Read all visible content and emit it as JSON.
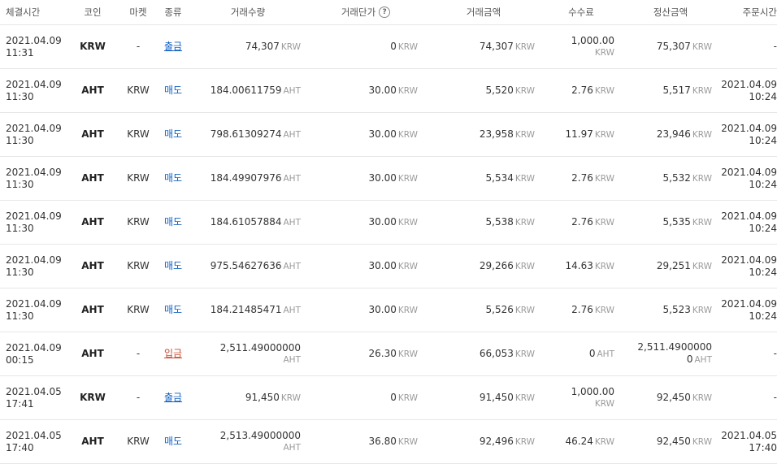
{
  "headers": {
    "time": "체결시간",
    "coin": "코인",
    "market": "마켓",
    "type": "종류",
    "volume": "거래수량",
    "price": "거래단가",
    "amount": "거래금액",
    "fee": "수수료",
    "settle": "정산금액",
    "order_time": "주문시간"
  },
  "help_icon": "?",
  "rows": [
    {
      "date": "2021.04.09",
      "time": "11:31",
      "coin": "KRW",
      "market": "-",
      "type": "출금",
      "type_kind": "withdraw",
      "volume": "74,307",
      "volume_unit": "KRW",
      "price": "0",
      "price_unit": "KRW",
      "amount": "74,307",
      "amount_unit": "KRW",
      "fee": "1,000.00",
      "fee_unit": "KRW",
      "fee_wrap": true,
      "settle": "75,307",
      "settle_unit": "KRW",
      "settle_wrap": false,
      "order_date": "-",
      "order_time": ""
    },
    {
      "date": "2021.04.09",
      "time": "11:30",
      "coin": "AHT",
      "market": "KRW",
      "type": "매도",
      "type_kind": "sell",
      "volume": "184.00611759",
      "volume_unit": "AHT",
      "price": "30.00",
      "price_unit": "KRW",
      "amount": "5,520",
      "amount_unit": "KRW",
      "fee": "2.76",
      "fee_unit": "KRW",
      "fee_wrap": false,
      "settle": "5,517",
      "settle_unit": "KRW",
      "settle_wrap": false,
      "order_date": "2021.04.09",
      "order_time": "10:24"
    },
    {
      "date": "2021.04.09",
      "time": "11:30",
      "coin": "AHT",
      "market": "KRW",
      "type": "매도",
      "type_kind": "sell",
      "volume": "798.61309274",
      "volume_unit": "AHT",
      "price": "30.00",
      "price_unit": "KRW",
      "amount": "23,958",
      "amount_unit": "KRW",
      "fee": "11.97",
      "fee_unit": "KRW",
      "fee_wrap": false,
      "settle": "23,946",
      "settle_unit": "KRW",
      "settle_wrap": false,
      "order_date": "2021.04.09",
      "order_time": "10:24"
    },
    {
      "date": "2021.04.09",
      "time": "11:30",
      "coin": "AHT",
      "market": "KRW",
      "type": "매도",
      "type_kind": "sell",
      "volume": "184.49907976",
      "volume_unit": "AHT",
      "price": "30.00",
      "price_unit": "KRW",
      "amount": "5,534",
      "amount_unit": "KRW",
      "fee": "2.76",
      "fee_unit": "KRW",
      "fee_wrap": false,
      "settle": "5,532",
      "settle_unit": "KRW",
      "settle_wrap": false,
      "order_date": "2021.04.09",
      "order_time": "10:24"
    },
    {
      "date": "2021.04.09",
      "time": "11:30",
      "coin": "AHT",
      "market": "KRW",
      "type": "매도",
      "type_kind": "sell",
      "volume": "184.61057884",
      "volume_unit": "AHT",
      "price": "30.00",
      "price_unit": "KRW",
      "amount": "5,538",
      "amount_unit": "KRW",
      "fee": "2.76",
      "fee_unit": "KRW",
      "fee_wrap": false,
      "settle": "5,535",
      "settle_unit": "KRW",
      "settle_wrap": false,
      "order_date": "2021.04.09",
      "order_time": "10:24"
    },
    {
      "date": "2021.04.09",
      "time": "11:30",
      "coin": "AHT",
      "market": "KRW",
      "type": "매도",
      "type_kind": "sell",
      "volume": "975.54627636",
      "volume_unit": "AHT",
      "price": "30.00",
      "price_unit": "KRW",
      "amount": "29,266",
      "amount_unit": "KRW",
      "fee": "14.63",
      "fee_unit": "KRW",
      "fee_wrap": false,
      "settle": "29,251",
      "settle_unit": "KRW",
      "settle_wrap": false,
      "order_date": "2021.04.09",
      "order_time": "10:24"
    },
    {
      "date": "2021.04.09",
      "time": "11:30",
      "coin": "AHT",
      "market": "KRW",
      "type": "매도",
      "type_kind": "sell",
      "volume": "184.21485471",
      "volume_unit": "AHT",
      "price": "30.00",
      "price_unit": "KRW",
      "amount": "5,526",
      "amount_unit": "KRW",
      "fee": "2.76",
      "fee_unit": "KRW",
      "fee_wrap": false,
      "settle": "5,523",
      "settle_unit": "KRW",
      "settle_wrap": false,
      "order_date": "2021.04.09",
      "order_time": "10:24"
    },
    {
      "date": "2021.04.09",
      "time": "00:15",
      "coin": "AHT",
      "market": "-",
      "type": "입금",
      "type_kind": "deposit",
      "volume": "2,511.49000000",
      "volume_unit": "AHT",
      "volume_wrap": true,
      "price": "26.30",
      "price_unit": "KRW",
      "amount": "66,053",
      "amount_unit": "KRW",
      "fee": "0",
      "fee_unit": "AHT",
      "fee_wrap": false,
      "settle": "2,511.4900000",
      "settle_unit": "AHT",
      "settle_second": "0",
      "settle_wrap": true,
      "order_date": "-",
      "order_time": ""
    },
    {
      "date": "2021.04.05",
      "time": "17:41",
      "coin": "KRW",
      "market": "-",
      "type": "출금",
      "type_kind": "withdraw",
      "volume": "91,450",
      "volume_unit": "KRW",
      "price": "0",
      "price_unit": "KRW",
      "amount": "91,450",
      "amount_unit": "KRW",
      "fee": "1,000.00",
      "fee_unit": "KRW",
      "fee_wrap": true,
      "settle": "92,450",
      "settle_unit": "KRW",
      "settle_wrap": false,
      "order_date": "-",
      "order_time": ""
    },
    {
      "date": "2021.04.05",
      "time": "17:40",
      "coin": "AHT",
      "market": "KRW",
      "type": "매도",
      "type_kind": "sell",
      "volume": "2,513.49000000",
      "volume_unit": "AHT",
      "volume_wrap": true,
      "price": "36.80",
      "price_unit": "KRW",
      "amount": "92,496",
      "amount_unit": "KRW",
      "fee": "46.24",
      "fee_unit": "KRW",
      "fee_wrap": false,
      "settle": "92,450",
      "settle_unit": "KRW",
      "settle_wrap": false,
      "order_date": "2021.04.05",
      "order_time": "17:40"
    }
  ]
}
